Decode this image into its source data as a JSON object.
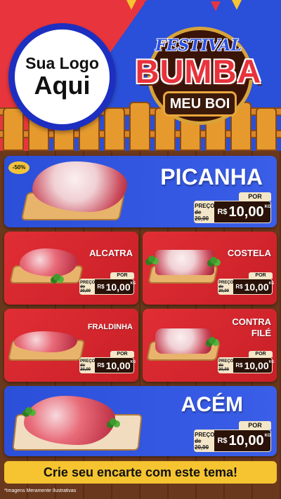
{
  "colors": {
    "red": "#e12e35",
    "blue": "#2b4fd8",
    "yellow": "#f5c430",
    "dark_brown": "#2a1208",
    "cream": "#f4e6c8"
  },
  "header": {
    "logo_line1": "Sua Logo",
    "logo_line2": "Aqui",
    "festival_top": "FESTIVAL",
    "festival_mid": "BUMBA",
    "festival_bot": "MEU BOI"
  },
  "products": [
    {
      "name": "PICANHA",
      "discount": "-50%",
      "por": "POR",
      "preco_label": "PREÇO",
      "old_price": "de 20,00",
      "currency": "R$",
      "price": "10,00",
      "unit": "KG"
    },
    {
      "name": "ALCATRA",
      "por": "POR",
      "preco_label": "PREÇO",
      "old_price": "de 20,00",
      "currency": "R$",
      "price": "10,00",
      "unit": "KG"
    },
    {
      "name": "COSTELA",
      "por": "POR",
      "preco_label": "PREÇO",
      "old_price": "de 20,00",
      "currency": "R$",
      "price": "10,00",
      "unit": "KG"
    },
    {
      "name": "FRALDINHA",
      "por": "POR",
      "preco_label": "PREÇO",
      "old_price": "de 20,00",
      "currency": "R$",
      "price": "10,00",
      "unit": "KG"
    },
    {
      "name_line1": "CONTRA",
      "name_line2": "FILÉ",
      "por": "POR",
      "preco_label": "PREÇO",
      "old_price": "de 20,00",
      "currency": "R$",
      "price": "10,00",
      "unit": "KG"
    },
    {
      "name": "ACÉM",
      "por": "POR",
      "preco_label": "PREÇO",
      "old_price": "de 20,00",
      "currency": "R$",
      "price": "10,00",
      "unit": "KG"
    }
  ],
  "footer": {
    "cta": "Crie seu encarte com este tema!",
    "disclaimer": "*Imagens Meramente Ilustrativas"
  }
}
